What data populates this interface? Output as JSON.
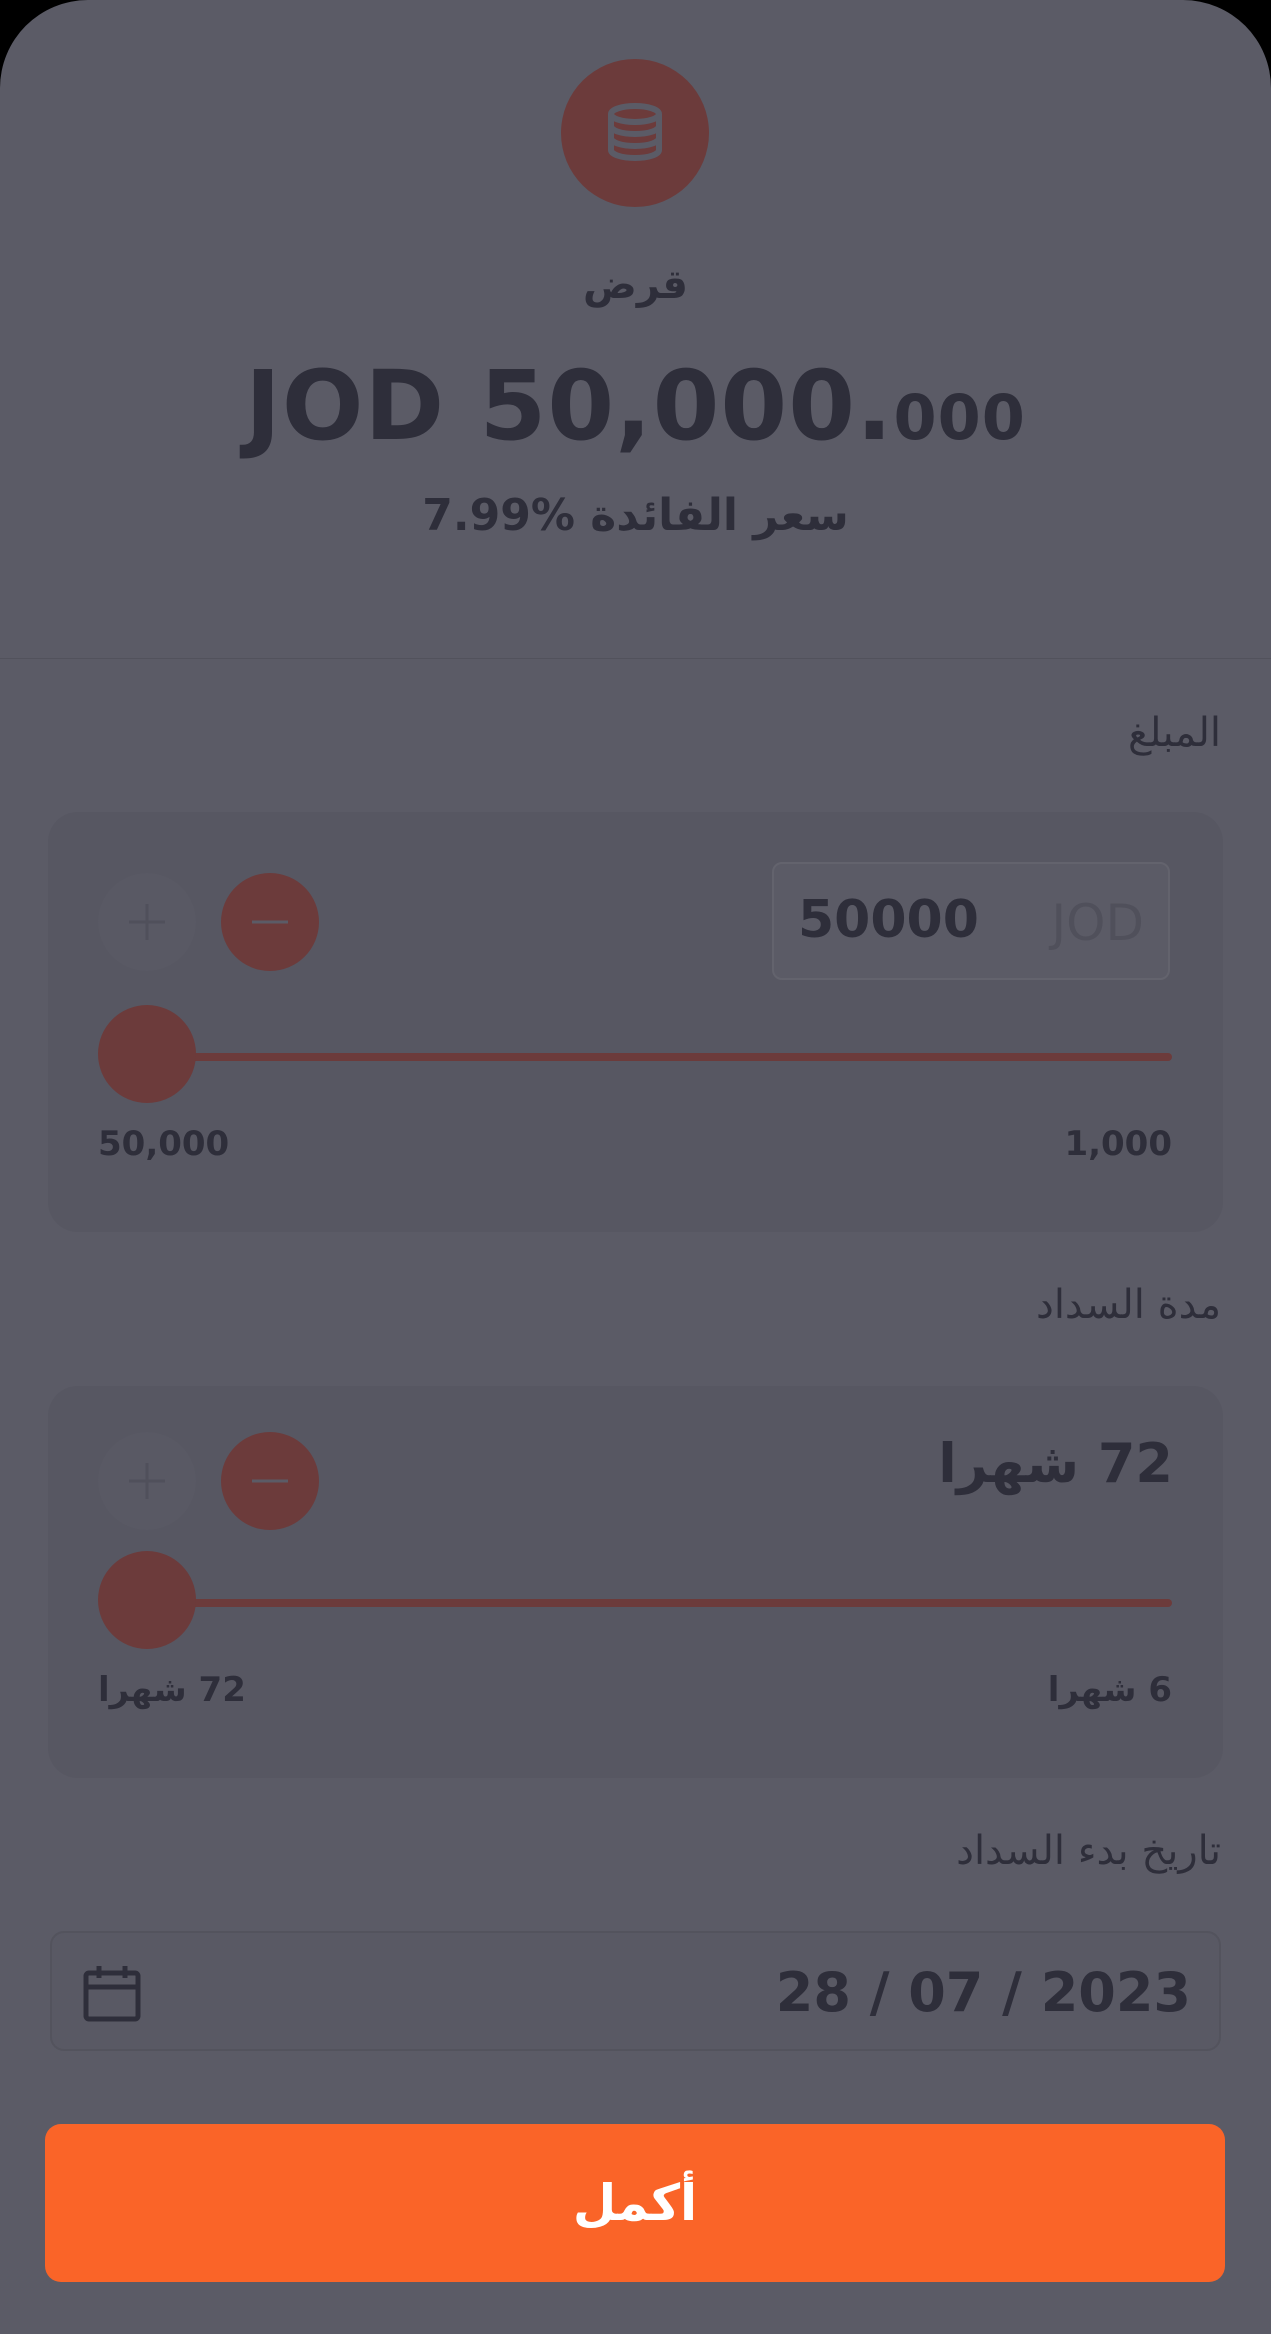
{
  "header": {
    "icon": "coins-stack-icon",
    "loan_label": "قرض",
    "amount_main": "JOD 50,000.",
    "amount_decimals": "000",
    "interest_rate": "7.99% سعر الفائدة"
  },
  "amount_section": {
    "label": "المبلغ",
    "input_value": "50000",
    "currency": "JOD",
    "slider_min_label": "1,000",
    "slider_max_label": "50,000",
    "slider_value": 50000
  },
  "period_section": {
    "label": "مدة السداد",
    "value": "72 شهرا",
    "slider_min_label": "6 شهرا",
    "slider_max_label": "72 شهرا",
    "slider_value_months": 72
  },
  "date_section": {
    "label": "تاريخ بدء السداد",
    "value": "28 / 07 / 2023",
    "icon": "calendar-icon"
  },
  "continue_button": {
    "label": "أكمل"
  },
  "colors": {
    "accent": "#fa6428",
    "overlay_accent": "#6c3b3b",
    "overlay_bg": "#5b5b66",
    "text": "#2e2e3a"
  }
}
